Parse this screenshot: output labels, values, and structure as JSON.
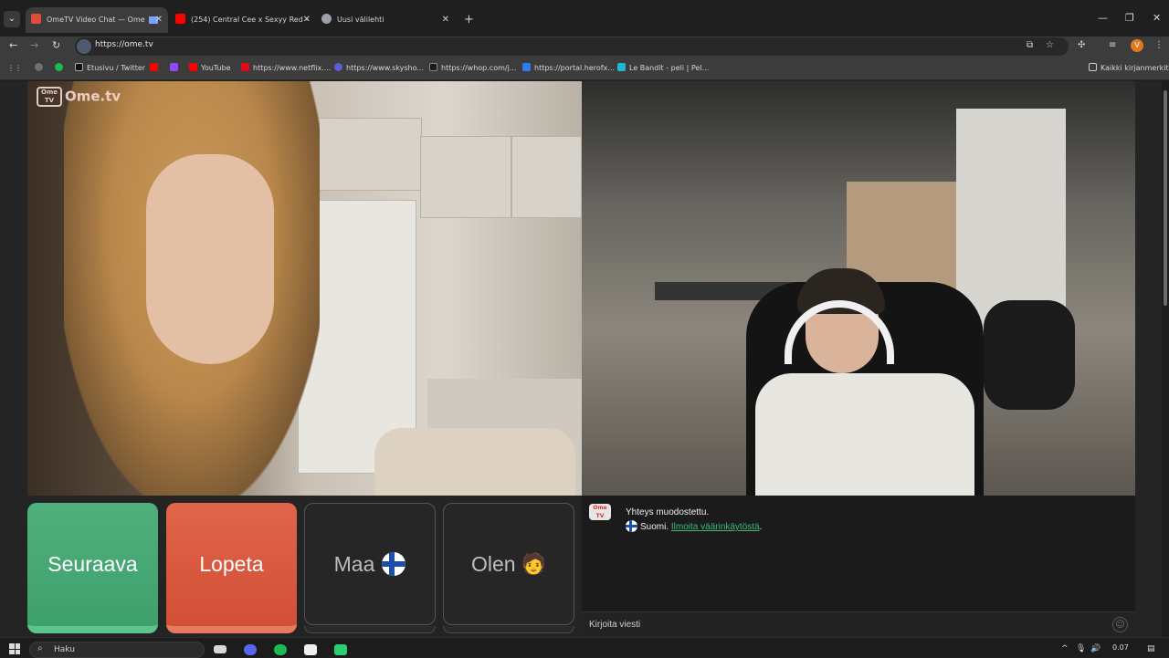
{
  "browser": {
    "tabs": [
      {
        "title": "OmeTV Video Chat — Ome",
        "favicon_color": "#e24b3a",
        "active": true
      },
      {
        "title": "(254) Central Cee x Sexyy Red -",
        "favicon_color": "#ff0000",
        "active": false
      },
      {
        "title": "Uusi välilehti",
        "favicon_color": "#9aa0a6",
        "active": false
      }
    ],
    "new_tab": "+",
    "window_controls": {
      "minimize": "—",
      "maximize": "❐",
      "close": "✕"
    },
    "url": "https://ome.tv",
    "profile_initial": "V",
    "bookmarks": [
      {
        "label": "",
        "color": "#6f6f6f"
      },
      {
        "label": "",
        "color": "#1db954"
      },
      {
        "label": "Etusivu / Twitter",
        "color": "#111111"
      },
      {
        "label": "",
        "color": "#ff0000"
      },
      {
        "label": "",
        "color": "#9146ff"
      },
      {
        "label": "YouTube",
        "color": "#ff0000"
      },
      {
        "label": "https://www.netflix....",
        "color": "#e50914"
      },
      {
        "label": "https://www.skysho...",
        "color": "#5a5fd6"
      },
      {
        "label": "https://whop.com/j...",
        "color": "#1a1a1a"
      },
      {
        "label": "https://portal.herofx...",
        "color": "#2e7df0"
      },
      {
        "label": "Le Bandit - peli | Pel...",
        "color": "#1fb7d4"
      }
    ],
    "all_bookmarks": "Kaikki kirjanmerkit"
  },
  "app": {
    "logo_text": "Ome.tv",
    "logo_box_text": "Ome TV",
    "buttons": {
      "next": "Seuraava",
      "stop": "Lopeta",
      "country": "Maa",
      "gender": "Olen"
    },
    "chat": {
      "logo_text": "Ome TV",
      "status": "Yhteys muodostettu.",
      "country": "Suomi.",
      "report_link": "Ilmoita väärinkäytöstä",
      "report_suffix": ".",
      "input_placeholder": "Kirjoita viesti",
      "emoji_icon": "☺"
    }
  },
  "taskbar": {
    "search_placeholder": "Haku",
    "time": "0.07"
  },
  "colors": {
    "next_button": "#3ea06c",
    "stop_button": "#d24f36",
    "report_link": "#3cb878"
  }
}
